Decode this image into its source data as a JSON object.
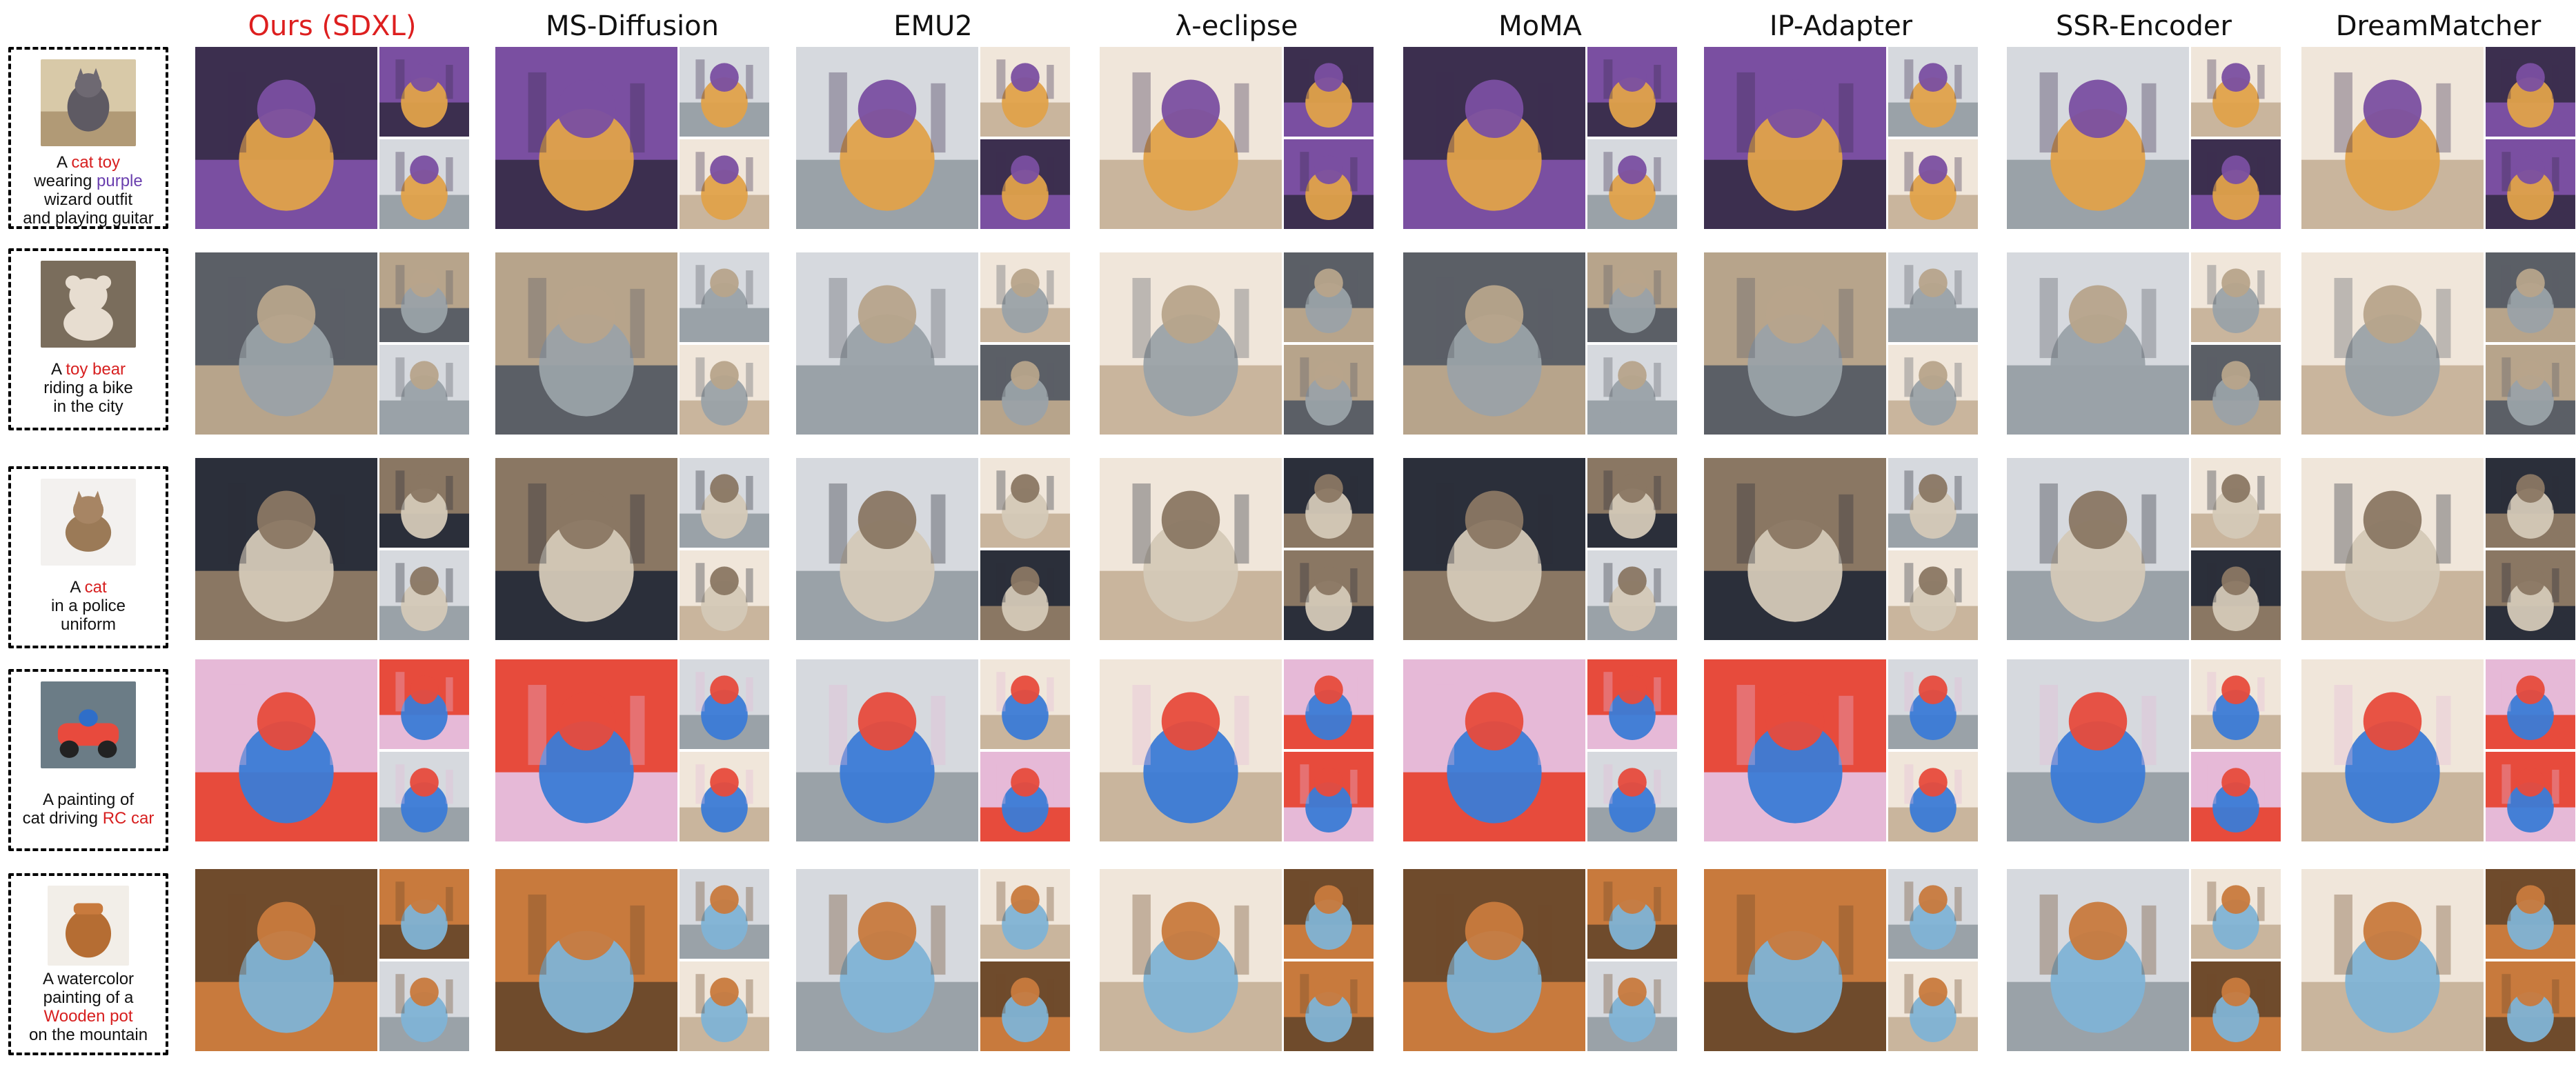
{
  "headers": [
    "Ours (SDXL)",
    "MS-Diffusion",
    "EMU2",
    "λ-eclipse",
    "MoMA",
    "IP-Adapter",
    "SSR-Encoder",
    "DreamMatcher"
  ],
  "prompts": [
    {
      "line1": "A ",
      "line1_accent": "cat toy",
      "line2a": "wearing ",
      "line2_accent": "purple",
      "line3": "wizard outfit",
      "line4": "and playing guitar"
    },
    {
      "line1": "A ",
      "line1_accent": "toy bear",
      "line2": "riding a bike",
      "line3": "in the city"
    },
    {
      "line1": "A ",
      "line1_accent": "cat",
      "line2": "in a police",
      "line3": "uniform"
    },
    {
      "line1": "A painting of",
      "line2": "cat driving ",
      "line2_accent": "RC car"
    },
    {
      "line1": "A watercolor",
      "line2": "painting of a",
      "line3_accent": "Wooden pot",
      "line4": "on the mountain"
    }
  ],
  "colors": {
    "ours_header": "#dd1f1f",
    "accent_red": "#d71f1f",
    "accent_purple": "#6a3fae",
    "row_themes": [
      [
        "#3c2f4f",
        "#7a4fa1",
        "#e0a24a"
      ],
      [
        "#5b5f66",
        "#b7a48b",
        "#9aa2a8"
      ],
      [
        "#2b2f3a",
        "#8a7763",
        "#d4c9b7"
      ],
      [
        "#e6b9d7",
        "#e74b3c",
        "#3b7bd6"
      ],
      [
        "#6f4b2c",
        "#c87a3d",
        "#7fb3d5"
      ]
    ]
  }
}
